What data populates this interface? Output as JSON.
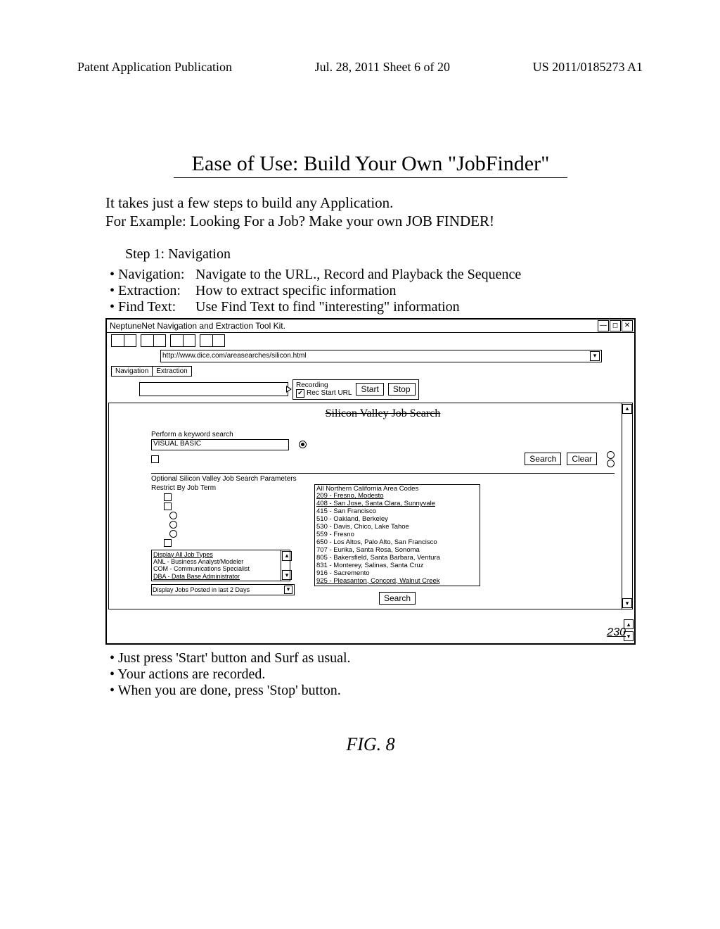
{
  "header": {
    "left": "Patent Application Publication",
    "center": "Jul. 28, 2011  Sheet 6 of 20",
    "right": "US 2011/0185273 A1"
  },
  "slide": {
    "title": "Ease of Use:  Build Your Own \"JobFinder\"",
    "desc_line1": "It takes just a few steps to build any Application.",
    "desc_line2": "For Example:  Looking For a Job? Make your own JOB FINDER!",
    "step": "Step 1: Navigation",
    "bullets": [
      {
        "label": "Navigation:",
        "text": "Navigate to the URL., Record and Playback the Sequence"
      },
      {
        "label": "Extraction:",
        "text": "How to extract specific information"
      },
      {
        "label": "Find Text:",
        "text": "Use Find Text to find \"interesting\" information"
      }
    ]
  },
  "app": {
    "title": "NeptuneNet Navigation and Extraction Tool Kit.",
    "url": "http://www.dice.com/areasearches/silicon.html",
    "tabs": {
      "navigation": "Navigation",
      "extraction": "Extraction"
    },
    "recording_label": "Recording",
    "rec_start_url": "Rec Start URL",
    "start": "Start",
    "stop": "Stop",
    "page_ref": "230"
  },
  "svj": {
    "title": "Silicon Valley Job Search",
    "keyword_label": "Perform a keyword search",
    "keyword_value": "VISUAL BASIC",
    "search": "Search",
    "clear": "Clear",
    "opt_heading": "Optional Silicon Valley Job Search Parameters",
    "restrict_label": "Restrict By Job Term",
    "jobtypes": {
      "title": "Display All Job Types",
      "items": [
        "ANL - Business Analyst/Modeler",
        "COM - Communications Specialist",
        "DBA - Data Base Administrator"
      ]
    },
    "posted": "Display Jobs Posted in last 2 Days",
    "areacodes": [
      "All Northern California Area Codes",
      "209 - Fresno, Modesto",
      "408 - San Jose, Santa Clara, Sunnyvale",
      "415 - San Francisco",
      "510 - Oakland, Berkeley",
      "530 - Davis, Chico, Lake Tahoe",
      "559 - Fresno",
      "650 - Los Altos, Palo Alto, San Francisco",
      "707 - Eurika, Santa Rosa, Sonoma",
      "805 - Bakersfield, Santa Barbara, Ventura",
      "831 - Monterey, Salinas, Santa Cruz",
      "916 - Sacremento",
      "925 - Pleasanton, Concord, Walnut Creek"
    ],
    "search2": "Search"
  },
  "post_bullets": [
    "Just press 'Start' button and Surf as usual.",
    "Your actions are recorded.",
    "When you are done, press 'Stop' button."
  ],
  "fig": "FIG. 8",
  "chart_data": {
    "type": "table",
    "description": "Patent figure showing a GUI screenshot of NeptuneNet recording tool over a job-search web page; no quantitative chart axes present.",
    "values": []
  }
}
